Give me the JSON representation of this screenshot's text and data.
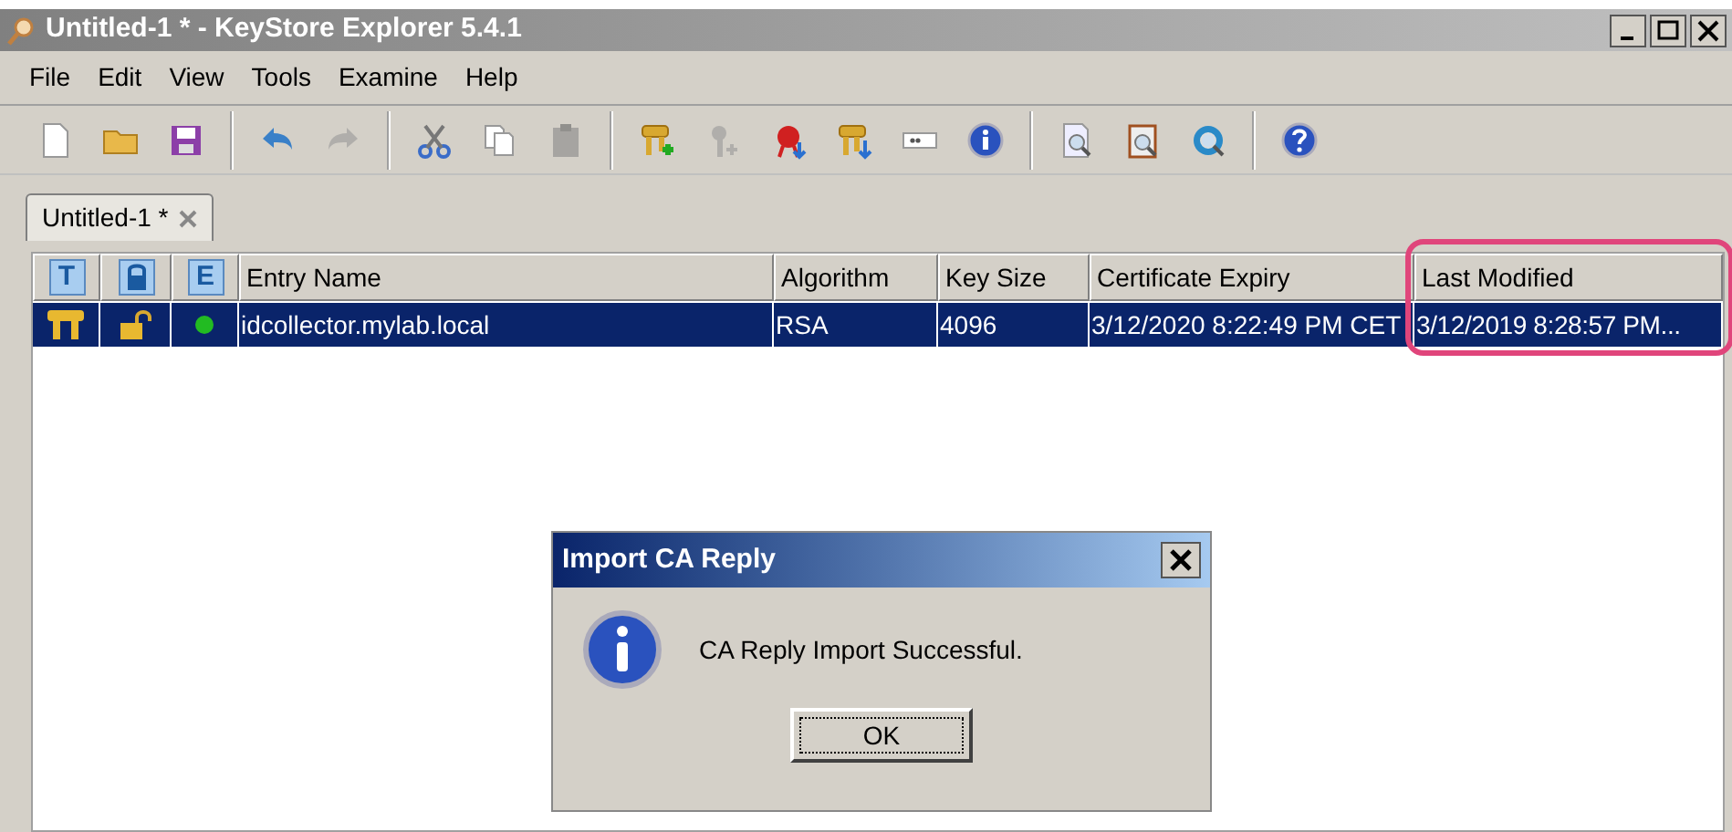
{
  "window": {
    "title": "Untitled-1 * - KeyStore Explorer 5.4.1"
  },
  "menu": [
    "File",
    "Edit",
    "View",
    "Tools",
    "Examine",
    "Help"
  ],
  "toolbar": [
    [
      {
        "kind": "new",
        "disabled": false
      },
      {
        "kind": "open",
        "disabled": false
      },
      {
        "kind": "save",
        "disabled": false
      }
    ],
    [
      {
        "kind": "undo",
        "disabled": false
      },
      {
        "kind": "redo",
        "disabled": true
      }
    ],
    [
      {
        "kind": "cut",
        "disabled": false
      },
      {
        "kind": "copy",
        "disabled": false
      },
      {
        "kind": "paste",
        "disabled": true
      }
    ],
    [
      {
        "kind": "keypair",
        "disabled": false
      },
      {
        "kind": "key",
        "disabled": true
      },
      {
        "kind": "cert",
        "disabled": false
      },
      {
        "kind": "keyimport",
        "disabled": false
      },
      {
        "kind": "password",
        "disabled": false
      },
      {
        "kind": "info",
        "disabled": false
      }
    ],
    [
      {
        "kind": "examine-file",
        "disabled": false
      },
      {
        "kind": "examine-clipboard",
        "disabled": false
      },
      {
        "kind": "examine-ssl",
        "disabled": false
      }
    ],
    [
      {
        "kind": "help",
        "disabled": false
      }
    ]
  ],
  "tabs": [
    {
      "label": "Untitled-1 *",
      "selected": true
    }
  ],
  "table": {
    "columns": [
      {
        "kind": "letter",
        "label": "T"
      },
      {
        "kind": "lock"
      },
      {
        "kind": "letter",
        "label": "E"
      },
      {
        "kind": "text",
        "label": "Entry Name"
      },
      {
        "kind": "text",
        "label": "Algorithm"
      },
      {
        "kind": "text",
        "label": "Key Size"
      },
      {
        "kind": "text",
        "label": "Certificate Expiry"
      },
      {
        "kind": "text",
        "label": "Last Modified"
      }
    ],
    "rows": [
      {
        "selected": true,
        "locked": false,
        "color": "#22bb22",
        "entry_name": "idcollector.mylab.local",
        "algorithm": "RSA",
        "key_size": "4096",
        "certificate_expiry": "3/12/2020 8:22:49 PM CET",
        "last_modified": "3/12/2019 8:28:57 PM..."
      }
    ]
  },
  "dialog": {
    "title": "Import CA Reply",
    "message": "CA Reply Import Successful.",
    "button": "OK"
  }
}
